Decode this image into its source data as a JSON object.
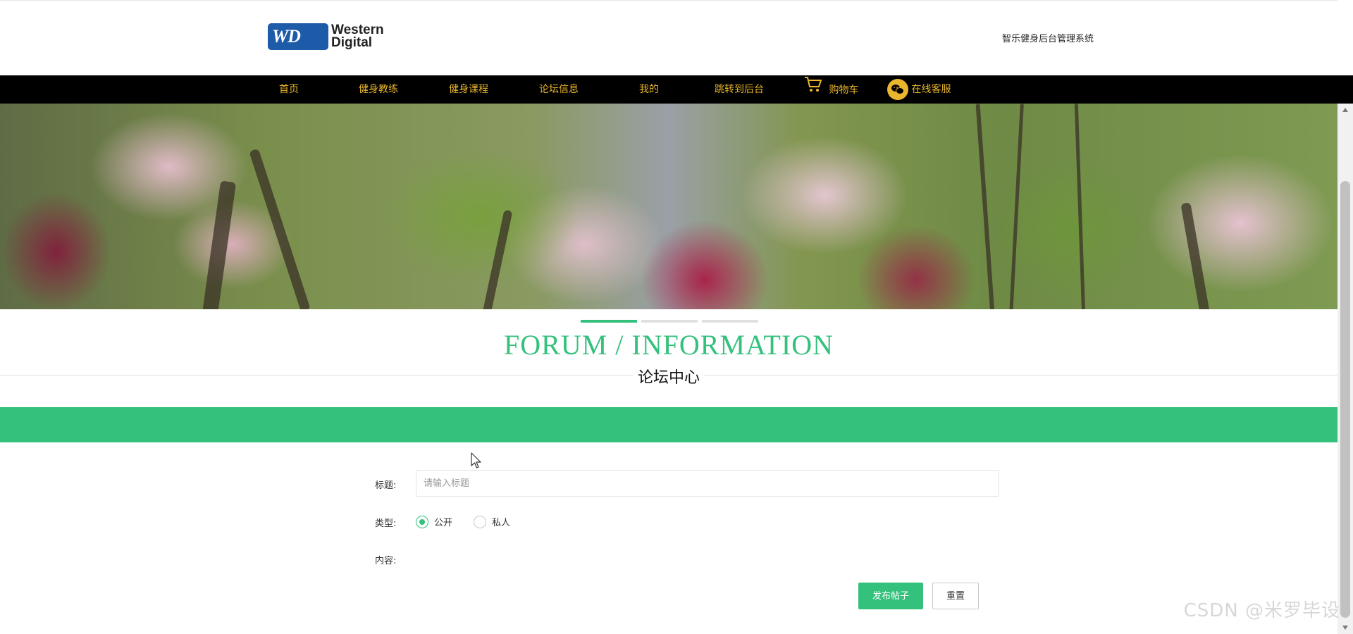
{
  "header": {
    "logo": {
      "badge": "WD",
      "line1": "Western",
      "line2": "Digital"
    },
    "site_title": "智乐健身后台管理系统"
  },
  "nav": {
    "items": [
      {
        "label": "首页"
      },
      {
        "label": "健身教练"
      },
      {
        "label": "健身课程"
      },
      {
        "label": "论坛信息"
      },
      {
        "label": "我的"
      },
      {
        "label": "跳转到后台"
      },
      {
        "label": "购物车",
        "icon": "cart-icon"
      },
      {
        "label": "在线客服",
        "icon": "wechat-icon"
      }
    ],
    "accent_color": "#e9b62d"
  },
  "carousel": {
    "slides": 3,
    "active_index": 0
  },
  "section": {
    "title_en": "FORUM / INFORMATION",
    "title_cn": "论坛中心"
  },
  "form": {
    "title_label": "标题:",
    "title_placeholder": "请输入标题",
    "type_label": "类型:",
    "type_options": [
      "公开",
      "私人"
    ],
    "type_selected": "公开",
    "content_label": "内容:",
    "submit_label": "发布帖子",
    "reset_label": "重置"
  },
  "watermark": "CSDN @米罗毕设",
  "colors": {
    "primary": "#33c17c",
    "nav_bg": "#000000"
  }
}
